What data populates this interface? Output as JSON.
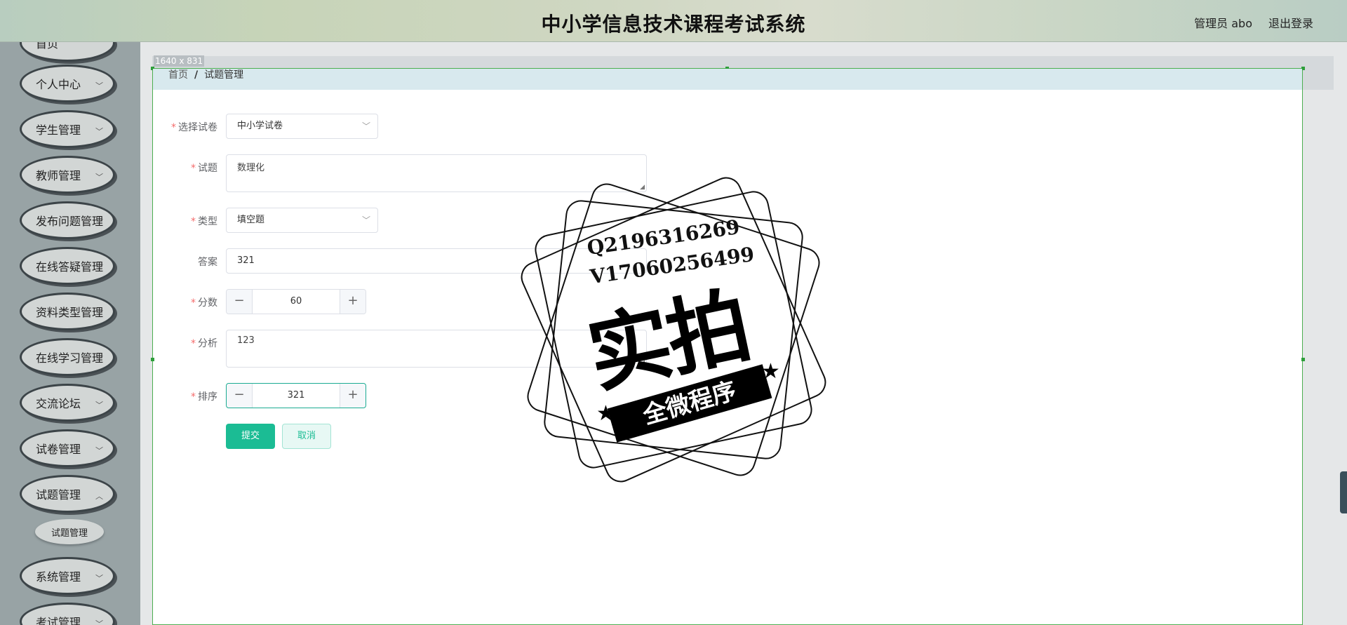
{
  "header": {
    "title": "中小学信息技术课程考试系统",
    "user": "管理员 abo",
    "logout": "退出登录"
  },
  "sidebar": {
    "items": [
      {
        "label": "首页"
      },
      {
        "label": "个人中心"
      },
      {
        "label": "学生管理"
      },
      {
        "label": "教师管理"
      },
      {
        "label": "发布问题管理"
      },
      {
        "label": "在线答疑管理"
      },
      {
        "label": "资料类型管理"
      },
      {
        "label": "在线学习管理"
      },
      {
        "label": "交流论坛"
      },
      {
        "label": "试卷管理"
      },
      {
        "label": "试题管理"
      },
      {
        "label": "系统管理"
      },
      {
        "label": "考试管理"
      }
    ],
    "submenu": {
      "label": "试题管理"
    }
  },
  "frame_size_label": "1640 x 831",
  "breadcrumb": {
    "home": "首页",
    "separator": "/",
    "current": "试题管理"
  },
  "form": {
    "paper": {
      "label": "选择试卷",
      "value": "中小学试卷"
    },
    "question": {
      "label": "试题",
      "value": "数理化"
    },
    "type": {
      "label": "类型",
      "value": "填空题"
    },
    "answer": {
      "label": "答案",
      "value": "321"
    },
    "score": {
      "label": "分数",
      "value": "60"
    },
    "analysis": {
      "label": "分析",
      "value": "123"
    },
    "order": {
      "label": "排序",
      "value": "321"
    },
    "submit": "提交",
    "cancel": "取消"
  },
  "watermark": {
    "line1": "Q2196316269",
    "line2": "V17060256499",
    "big": "实拍",
    "ribbon": "全微程序"
  }
}
